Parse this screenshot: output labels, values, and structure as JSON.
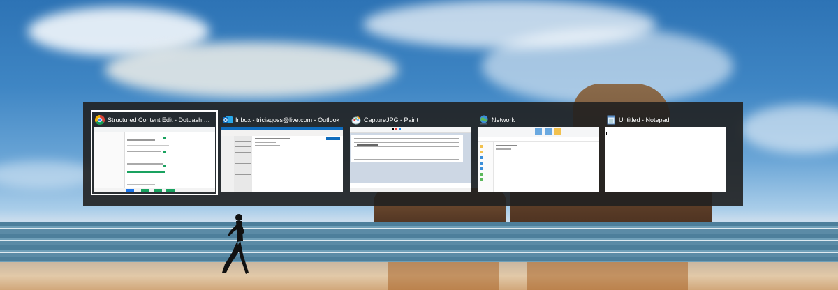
{
  "switcher": {
    "windows": [
      {
        "title": "Structured Content Edit - Dotdash CMS...",
        "icon": "chrome-icon",
        "selected": true
      },
      {
        "title": "Inbox - triciagoss@live.com - Outlook",
        "icon": "outlook-icon",
        "selected": false
      },
      {
        "title": "CaptureJPG - Paint",
        "icon": "paint-icon",
        "selected": false
      },
      {
        "title": "Network",
        "icon": "network-icon",
        "selected": false
      },
      {
        "title": "Untitled - Notepad",
        "icon": "notepad-icon",
        "selected": false
      }
    ]
  },
  "colors": {
    "switcher_bg": "#202020",
    "selected_outline": "#ffffff",
    "outlook_blue": "#0f6cbd",
    "chrome_green": "#1aa260"
  }
}
